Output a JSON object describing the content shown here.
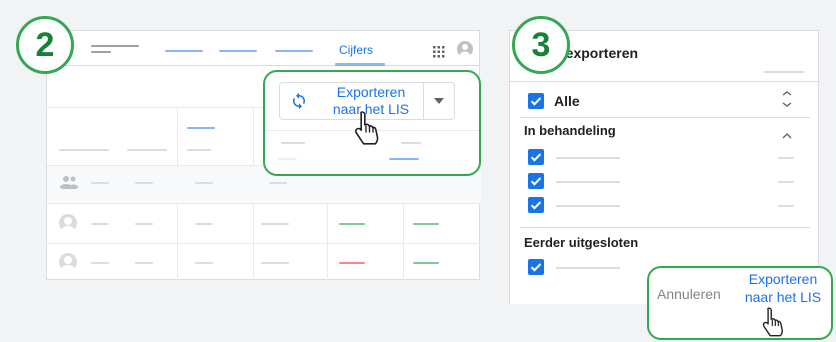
{
  "step2": {
    "badge": "2",
    "tab_label": "Cijfers",
    "export_button": {
      "line1": "Exporteren",
      "line2": "naar het LIS"
    }
  },
  "step3": {
    "badge": "3",
    "dialog_title": "s exporteren",
    "all_label": "Alle",
    "sections": [
      {
        "title": "In behandeling"
      },
      {
        "title": "Eerder uitgesloten"
      }
    ],
    "cancel_label": "Annuleren",
    "export_button": {
      "line1": "Exporteren",
      "line2": "naar het LIS"
    }
  },
  "colors": {
    "accent": "#1a73e8",
    "highlight": "#34a853",
    "badge_text": "#188038"
  },
  "icons": [
    "sync-icon",
    "dropdown-arrow-icon",
    "apps-grid-icon",
    "account-icon",
    "hand-pointer-icon",
    "checkbox-checked-icon",
    "expand-icon",
    "collapse-icon",
    "group-icon"
  ]
}
